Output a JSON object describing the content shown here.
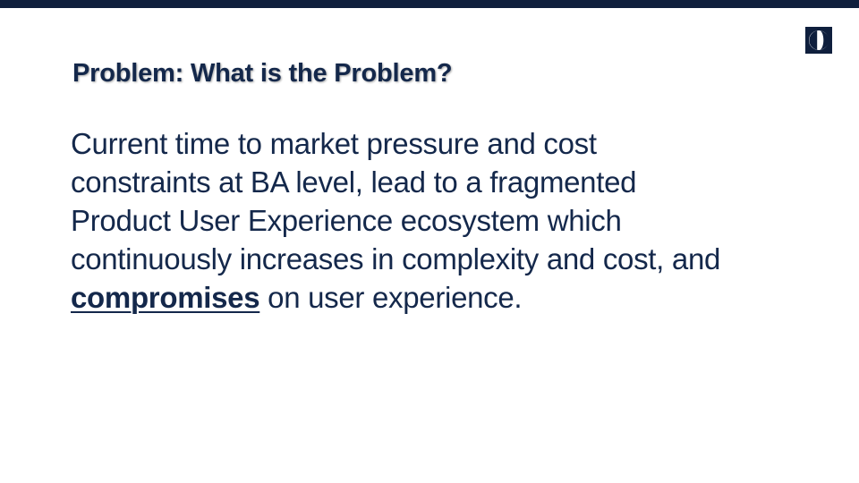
{
  "slide": {
    "title": "Problem:  What is the Problem?",
    "body": {
      "line1": "Current time to market pressure and cost",
      "line2": "constraints at BA level, lead to a fragmented",
      "line3": "Product User Experience ecosystem which",
      "line4": "continuously increases in complexity and cost, and",
      "emphasis": "compromises",
      "line5_rest": " on user experience."
    }
  },
  "logo": {
    "icon": "electrolux-logo-icon",
    "color": "#0f1f3d"
  },
  "colors": {
    "top_bar": "#0f1f3d",
    "text": "#14284b",
    "background": "#ffffff"
  }
}
